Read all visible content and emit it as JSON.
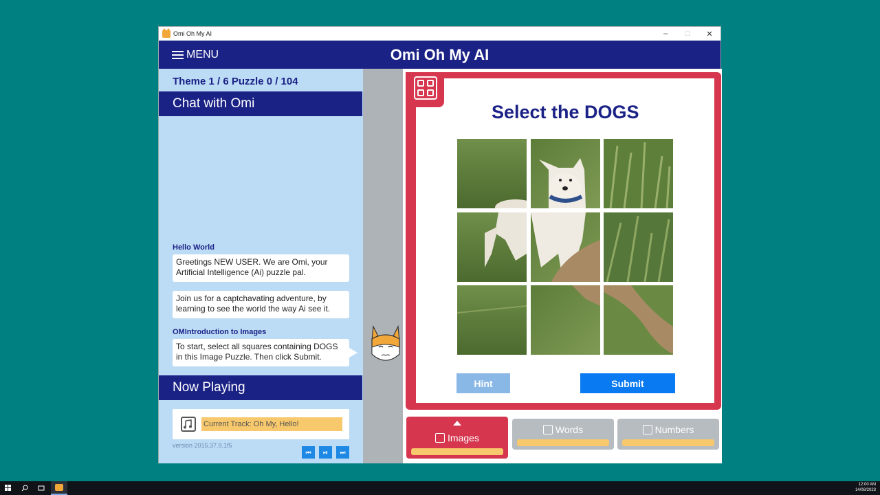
{
  "window": {
    "title": "Omi Oh My AI",
    "controls": {
      "minimize": "–",
      "maximize": "□",
      "close": "✕"
    }
  },
  "menubar": {
    "menu_label": "MENU",
    "app_title": "Omi Oh My AI"
  },
  "left_panel": {
    "progress": "Theme 1 / 6 Puzzle 0 / 104",
    "chat_header": "Chat with Omi",
    "messages": [
      {
        "sender": "Hello World",
        "text": "Greetings NEW USER. We are Omi, your Artificial Intelligence (Ai) puzzle pal."
      },
      {
        "sender": "",
        "text": "Join us for a captchavating adventure, by learning to see the world the way Ai see it."
      },
      {
        "sender": "OMIntroduction to Images",
        "text": "To start, select all squares containing DOGS in this Image Puzzle. Then click Submit."
      }
    ],
    "now_playing_header": "Now Playing",
    "track": "Current Track: Oh My, Hello!",
    "version": "version 2015.37.9.1f5",
    "controls": {
      "prev": "⏮",
      "play_pause": "⏯",
      "next": "⏭"
    }
  },
  "puzzle": {
    "title": "Select the DOGS",
    "hint_label": "Hint",
    "submit_label": "Submit",
    "tiles": [
      {
        "row": 1,
        "col": 1
      },
      {
        "row": 1,
        "col": 2
      },
      {
        "row": 1,
        "col": 3
      },
      {
        "row": 2,
        "col": 1
      },
      {
        "row": 2,
        "col": 2
      },
      {
        "row": 2,
        "col": 3
      },
      {
        "row": 3,
        "col": 1
      },
      {
        "row": 3,
        "col": 2
      },
      {
        "row": 3,
        "col": 3
      }
    ]
  },
  "tabs": [
    {
      "label": "Images",
      "active": true,
      "icon": "grid-icon"
    },
    {
      "label": "Words",
      "active": false,
      "icon": "document-icon"
    },
    {
      "label": "Numbers",
      "active": false,
      "icon": "numbers-icon"
    }
  ],
  "taskbar": {
    "time": "12:00 AM",
    "date": "14/08/2023"
  },
  "colors": {
    "navy": "#1b2286",
    "red": "#d6364e",
    "panel_blue": "#bcdcf6",
    "submit_blue": "#0a7af2",
    "hint_blue": "#8ab8e6",
    "teal_bg": "#008080"
  }
}
